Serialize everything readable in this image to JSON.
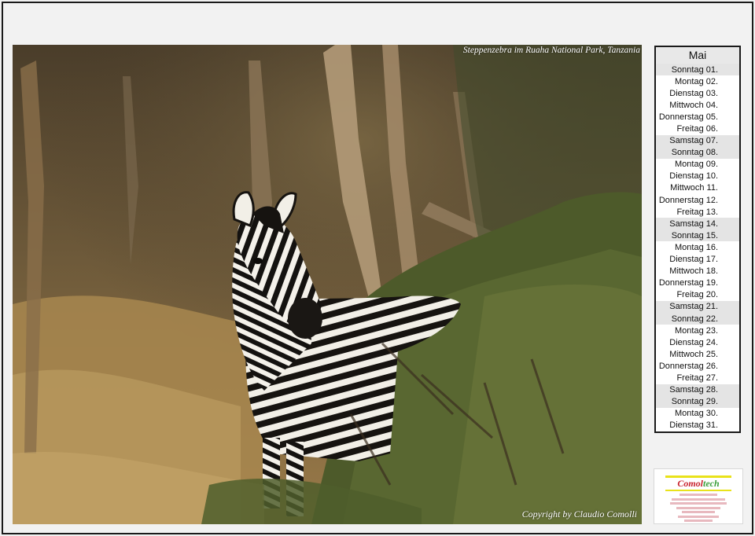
{
  "photo": {
    "caption": "Steppenzebra im Ruaha National Park, Tanzania",
    "copyright": "Copyright by Claudio Comolli",
    "subject_icon": "zebra-photo"
  },
  "calendar": {
    "month": "Mai",
    "days": [
      {
        "name": "Sonntag",
        "date": "01.",
        "weekend": true
      },
      {
        "name": "Montag",
        "date": "02.",
        "weekend": false
      },
      {
        "name": "Dienstag",
        "date": "03.",
        "weekend": false
      },
      {
        "name": "Mittwoch",
        "date": "04.",
        "weekend": false
      },
      {
        "name": "Donnerstag",
        "date": "05.",
        "weekend": false
      },
      {
        "name": "Freitag",
        "date": "06.",
        "weekend": false
      },
      {
        "name": "Samstag",
        "date": "07.",
        "weekend": true
      },
      {
        "name": "Sonntag",
        "date": "08.",
        "weekend": true
      },
      {
        "name": "Montag",
        "date": "09.",
        "weekend": false
      },
      {
        "name": "Dienstag",
        "date": "10.",
        "weekend": false
      },
      {
        "name": "Mittwoch",
        "date": "11.",
        "weekend": false
      },
      {
        "name": "Donnerstag",
        "date": "12.",
        "weekend": false
      },
      {
        "name": "Freitag",
        "date": "13.",
        "weekend": false
      },
      {
        "name": "Samstag",
        "date": "14.",
        "weekend": true
      },
      {
        "name": "Sonntag",
        "date": "15.",
        "weekend": true
      },
      {
        "name": "Montag",
        "date": "16.",
        "weekend": false
      },
      {
        "name": "Dienstag",
        "date": "17.",
        "weekend": false
      },
      {
        "name": "Mittwoch",
        "date": "18.",
        "weekend": false
      },
      {
        "name": "Donnerstag",
        "date": "19.",
        "weekend": false
      },
      {
        "name": "Freitag",
        "date": "20.",
        "weekend": false
      },
      {
        "name": "Samstag",
        "date": "21.",
        "weekend": true
      },
      {
        "name": "Sonntag",
        "date": "22.",
        "weekend": true
      },
      {
        "name": "Montag",
        "date": "23.",
        "weekend": false
      },
      {
        "name": "Dienstag",
        "date": "24.",
        "weekend": false
      },
      {
        "name": "Mittwoch",
        "date": "25.",
        "weekend": false
      },
      {
        "name": "Donnerstag",
        "date": "26.",
        "weekend": false
      },
      {
        "name": "Freitag",
        "date": "27.",
        "weekend": false
      },
      {
        "name": "Samstag",
        "date": "28.",
        "weekend": true
      },
      {
        "name": "Sonntag",
        "date": "29.",
        "weekend": true
      },
      {
        "name": "Montag",
        "date": "30.",
        "weekend": false
      },
      {
        "name": "Dienstag",
        "date": "31.",
        "weekend": false
      }
    ]
  },
  "logo": {
    "name_part1": "Comol",
    "name_part2": "tech",
    "color_red": "#c8222d",
    "color_green": "#3a9e3a",
    "color_yellow": "#e9e21a"
  }
}
